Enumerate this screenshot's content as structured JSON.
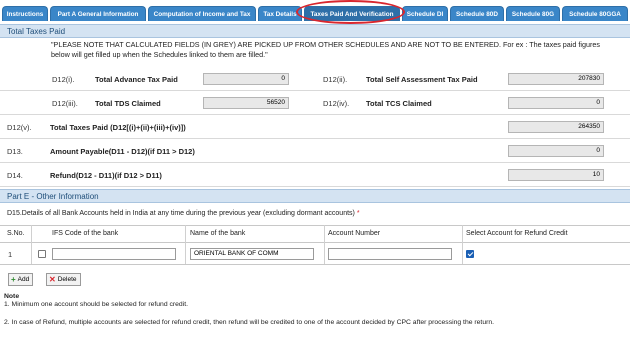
{
  "tabs": [
    {
      "label": "Instructions"
    },
    {
      "label": "Part A General Information"
    },
    {
      "label": "Computation of Income and Tax"
    },
    {
      "label": "Tax Details"
    },
    {
      "label": "Taxes Paid And Verification"
    },
    {
      "label": "Schedule DI"
    },
    {
      "label": "Schedule 80D"
    },
    {
      "label": "Schedule 80G"
    },
    {
      "label": "Schedule 80GGA"
    }
  ],
  "taxes_paid": {
    "title": "Total Taxes Paid",
    "note": "\"PLEASE NOTE THAT CALCULATED FIELDS (IN GREY) ARE PICKED UP FROM OTHER SCHEDULES AND ARE NOT TO BE ENTERED. For ex : The taxes paid figures below will get filled up when the Schedules linked to them are filled.\"",
    "d12i": {
      "code": "D12(i).",
      "label": "Total Advance Tax Paid",
      "value": "0"
    },
    "d12ii": {
      "code": "D12(ii).",
      "label": "Total Self Assessment Tax Paid",
      "value": "207830"
    },
    "d12iii": {
      "code": "D12(iii).",
      "label": "Total TDS Claimed",
      "value": "56520"
    },
    "d12iv": {
      "code": "D12(iv).",
      "label": "Total TCS Claimed",
      "value": "0"
    },
    "d12v": {
      "code": "D12(v).",
      "label": "Total Taxes Paid (D12[(i)+(ii)+(iii)+(iv)])",
      "value": "264350"
    },
    "d13": {
      "code": "D13.",
      "label": "Amount Payable(D11 - D12)(if D11 > D12)",
      "value": "0"
    },
    "d14": {
      "code": "D14.",
      "label": "Refund(D12 - D11)(if D12 > D11)",
      "value": "10"
    }
  },
  "part_e": {
    "title": "Part E - Other Information",
    "caption": "D15.Details of all Bank Accounts held in India at any time during the previous year (excluding dormant accounts)",
    "required_mark": "*",
    "columns": [
      "S.No.",
      "IFS Code of the bank",
      "Name of the bank",
      "Account Number",
      "Select Account for Refund Credit"
    ],
    "rows": [
      {
        "sno": "1",
        "ifsc": "",
        "bank_name": "ORIENTAL BANK OF COMM",
        "account_number": "",
        "refund_selected": true
      }
    ],
    "add_label": "Add",
    "delete_label": "Delete"
  },
  "notes": {
    "title": "Note",
    "items": [
      "1. Minimum one account should be selected for refund credit.",
      "2. In case of Refund, multiple accounts are selected for refund credit, then refund will be credited to one of the account decided by CPC after processing the return."
    ]
  },
  "colors": {
    "tab": "#3a86c8",
    "section_bg": "#d4e3f2",
    "highlight": "#d9262e"
  }
}
